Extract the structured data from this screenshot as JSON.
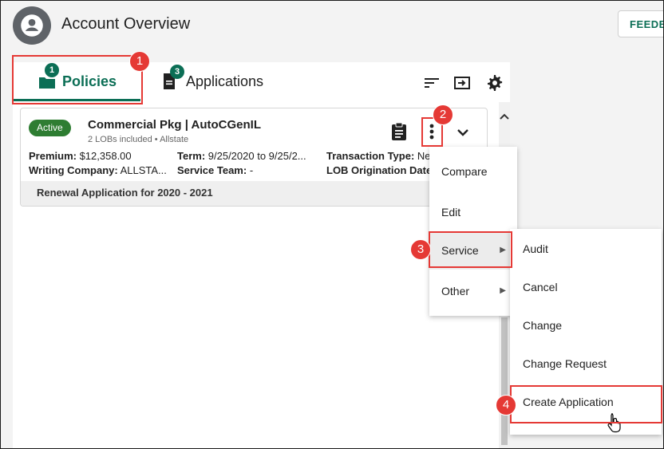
{
  "header": {
    "title": "Account Overview",
    "feedback_label": "FEEDB"
  },
  "tabs": [
    {
      "label": "Policies",
      "badge": "1"
    },
    {
      "label": "Applications",
      "badge": "3"
    }
  ],
  "callouts": [
    "1",
    "2",
    "3",
    "4"
  ],
  "policy_card": {
    "status": "Active",
    "name": "Commercial Pkg | AutoCGenIL",
    "subtitle": "2 LOBs included • Allstate",
    "premium_label": "Premium:",
    "premium_value": " $12,358.00",
    "term_label": "Term:",
    "term_value": " 9/25/2020 to 9/25/2...",
    "transaction_type_label": "Transaction Type:",
    "transaction_type_value": " Ne",
    "writing_company_label": "Writing Company:",
    "writing_company_value": " ALLSTA...",
    "service_team_label": "Service Team:",
    "service_team_value": " -",
    "lob_origination_label": "LOB Origination Date",
    "footer": "Renewal Application for 2020 - 2021"
  },
  "menu_primary": [
    {
      "label": "Compare"
    },
    {
      "label": "Edit"
    },
    {
      "label": "Service"
    },
    {
      "label": "Other"
    }
  ],
  "menu_service": [
    {
      "label": "Audit"
    },
    {
      "label": "Cancel"
    },
    {
      "label": "Change"
    },
    {
      "label": "Change Request"
    },
    {
      "label": "Create Application"
    }
  ],
  "colors": {
    "brand": "#0b6e55",
    "status_active": "#2e7d32",
    "callout": "#e53935"
  }
}
